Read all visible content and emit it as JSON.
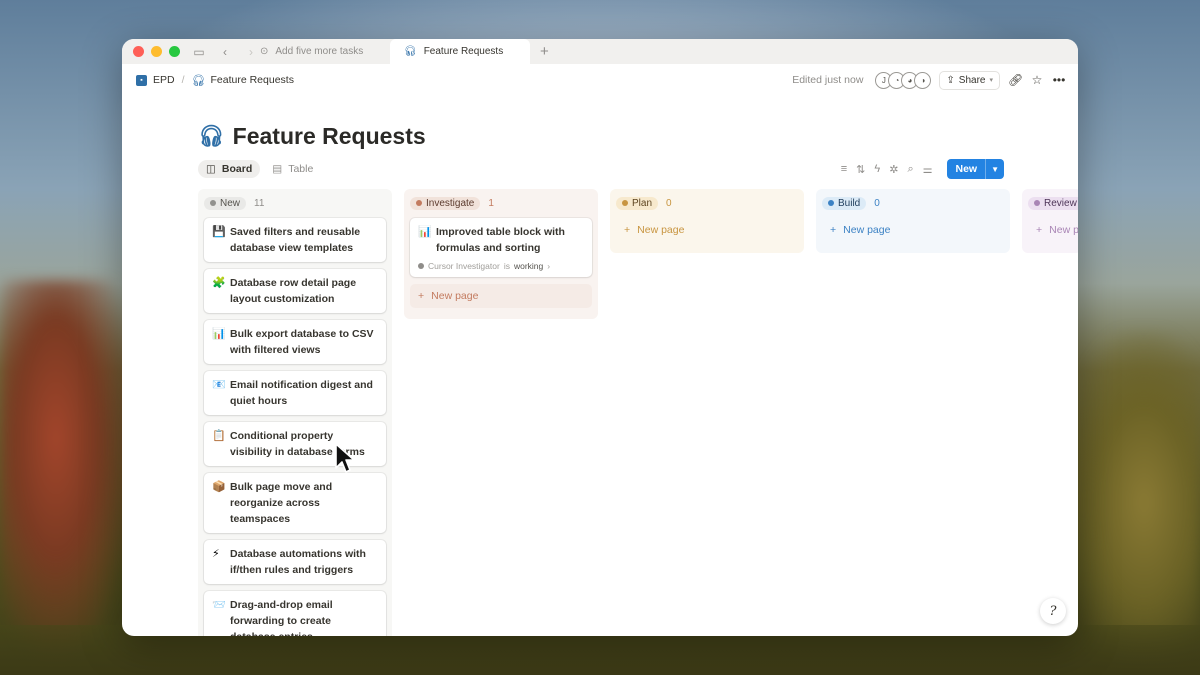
{
  "window": {
    "tabs": [
      {
        "label": "Add five more tasks",
        "icon": "task-icon"
      },
      {
        "label": "Feature Requests",
        "icon": "headset-icon"
      }
    ]
  },
  "topbar": {
    "workspace": "EPD",
    "page": "Feature Requests",
    "edited": "Edited just now",
    "avatar_initial": "J",
    "share_label": "Share"
  },
  "page": {
    "title": "Feature Requests",
    "title_icon": "headset-icon"
  },
  "views": {
    "board_label": "Board",
    "table_label": "Table",
    "new_label": "New"
  },
  "columns": [
    {
      "name": "New",
      "count": "11",
      "color": "#91918e",
      "cards": [
        {
          "icon": "💾",
          "title": "Saved filters and reusable database view templates"
        },
        {
          "icon": "🧩",
          "title": "Database row detail page layout customization"
        },
        {
          "icon": "📊",
          "title": "Bulk export database to CSV with filtered views"
        },
        {
          "icon": "📧",
          "title": "Email notification digest and quiet hours"
        },
        {
          "icon": "📋",
          "title": "Conditional property visibility in database forms"
        },
        {
          "icon": "📦",
          "title": "Bulk page move and reorganize across teamspaces"
        },
        {
          "icon": "⚡",
          "title": "Database automations with if/then rules and triggers"
        },
        {
          "icon": "📨",
          "title": "Drag-and-drop email forwarding to create database entries"
        }
      ]
    },
    {
      "name": "Investigate",
      "count": "1",
      "color": "#c37b5f",
      "cards": [
        {
          "icon": "📊",
          "title": "Improved table block with formulas and sorting",
          "status_agent": "Cursor Investigator",
          "status_text": "is",
          "status_state": "working"
        }
      ],
      "new_page": "New page"
    },
    {
      "name": "Plan",
      "count": "0",
      "color": "#c89540",
      "new_page": "New page"
    },
    {
      "name": "Build",
      "count": "0",
      "color": "#3c82c4",
      "new_page": "New page"
    },
    {
      "name": "Review",
      "color": "#a985b5",
      "new_page": "New page"
    }
  ]
}
